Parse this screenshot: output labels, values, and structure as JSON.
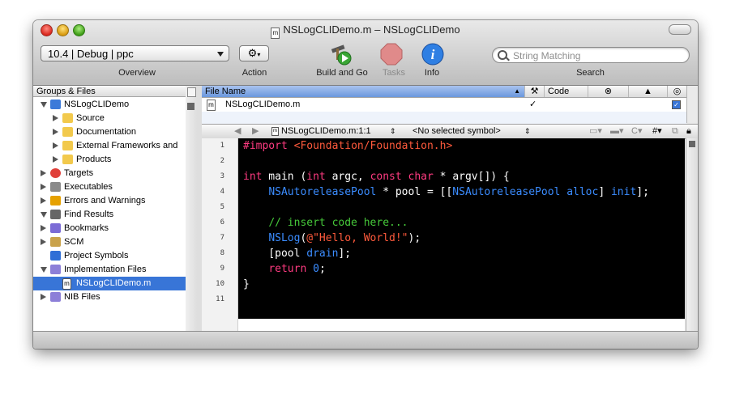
{
  "window": {
    "title": "NSLogCLIDemo.m – NSLogCLIDemo",
    "title_icon": "m-file-icon"
  },
  "toolbar": {
    "overview_value": "10.4 | Debug | ppc",
    "overview_label": "Overview",
    "action_label": "Action",
    "build_label": "Build and Go",
    "tasks_label": "Tasks",
    "info_label": "Info",
    "search_label": "Search",
    "search_placeholder": "String Matching"
  },
  "sidebar": {
    "header": "Groups & Files",
    "items": [
      {
        "label": "NSLogCLIDemo",
        "icon": "project-icon",
        "state": "open",
        "level": 0
      },
      {
        "label": "Source",
        "icon": "folder-icon",
        "state": "closed",
        "level": 1
      },
      {
        "label": "Documentation",
        "icon": "folder-icon",
        "state": "closed",
        "level": 1
      },
      {
        "label": "External Frameworks and",
        "icon": "folder-icon",
        "state": "closed",
        "level": 1
      },
      {
        "label": "Products",
        "icon": "folder-icon",
        "state": "closed",
        "level": 1
      },
      {
        "label": "Targets",
        "icon": "target-icon",
        "state": "closed",
        "level": 0
      },
      {
        "label": "Executables",
        "icon": "executable-icon",
        "state": "closed",
        "level": 0
      },
      {
        "label": "Errors and Warnings",
        "icon": "warning-icon",
        "state": "closed",
        "level": 0
      },
      {
        "label": "Find Results",
        "icon": "magnifier-icon",
        "state": "open",
        "level": 0
      },
      {
        "label": "Bookmarks",
        "icon": "bookmarks-icon",
        "state": "closed",
        "level": 0
      },
      {
        "label": "SCM",
        "icon": "scm-icon",
        "state": "closed",
        "level": 0
      },
      {
        "label": "Project Symbols",
        "icon": "symbols-icon",
        "state": "none",
        "level": 0
      },
      {
        "label": "Implementation Files",
        "icon": "smart-group-icon",
        "state": "open",
        "level": 0
      },
      {
        "label": "NSLogCLIDemo.m",
        "icon": "m-file-icon",
        "state": "none",
        "level": 1,
        "selected": true
      },
      {
        "label": "NIB Files",
        "icon": "smart-group-icon",
        "state": "closed",
        "level": 0
      }
    ]
  },
  "file_table": {
    "headers": {
      "file_name": "File Name",
      "code": "Code"
    },
    "rows": [
      {
        "file_name": "NSLogCLIDemo.m",
        "built": "✓",
        "checked": true
      }
    ]
  },
  "editor_nav": {
    "file_position": "NSLogCLIDemo.m:1:1",
    "symbol": "<No selected symbol>"
  },
  "editor": {
    "line_numbers": [
      "1",
      "2",
      "3",
      "4",
      "5",
      "6",
      "7",
      "8",
      "9",
      "10",
      "11"
    ],
    "lines": [
      [
        {
          "t": "#import ",
          "c": "k1"
        },
        {
          "t": "<Foundation/Foundation.h>",
          "c": "k5"
        }
      ],
      [],
      [
        {
          "t": "int",
          "c": "k1"
        },
        {
          "t": " main (",
          "c": ""
        },
        {
          "t": "int",
          "c": "k1"
        },
        {
          "t": " argc, ",
          "c": ""
        },
        {
          "t": "const",
          "c": "k1"
        },
        {
          "t": " ",
          "c": ""
        },
        {
          "t": "char",
          "c": "k1"
        },
        {
          "t": " * argv[]) {",
          "c": ""
        }
      ],
      [
        {
          "t": "    ",
          "c": ""
        },
        {
          "t": "NSAutoreleasePool",
          "c": "k3"
        },
        {
          "t": " * pool = [[",
          "c": ""
        },
        {
          "t": "NSAutoreleasePool",
          "c": "k3"
        },
        {
          "t": " ",
          "c": ""
        },
        {
          "t": "alloc",
          "c": "k3"
        },
        {
          "t": "] ",
          "c": ""
        },
        {
          "t": "init",
          "c": "k3"
        },
        {
          "t": "];",
          "c": ""
        }
      ],
      [],
      [
        {
          "t": "    ",
          "c": ""
        },
        {
          "t": "// insert code here...",
          "c": "k4"
        }
      ],
      [
        {
          "t": "    ",
          "c": ""
        },
        {
          "t": "NSLog",
          "c": "k3"
        },
        {
          "t": "(",
          "c": ""
        },
        {
          "t": "@\"Hello, World!\"",
          "c": "k5"
        },
        {
          "t": ");",
          "c": ""
        }
      ],
      [
        {
          "t": "    [pool ",
          "c": ""
        },
        {
          "t": "drain",
          "c": "k3"
        },
        {
          "t": "];",
          "c": ""
        }
      ],
      [
        {
          "t": "    ",
          "c": ""
        },
        {
          "t": "return",
          "c": "k1"
        },
        {
          "t": " ",
          "c": ""
        },
        {
          "t": "0",
          "c": "k3"
        },
        {
          "t": ";",
          "c": ""
        }
      ],
      [
        {
          "t": "}",
          "c": ""
        }
      ],
      []
    ]
  },
  "colors": {
    "selection": "#3875d7",
    "editor_bg": "#000000",
    "keyword": "#ff3b81",
    "class": "#3b8cff",
    "comment": "#46c93a",
    "string": "#ff5a3c"
  }
}
